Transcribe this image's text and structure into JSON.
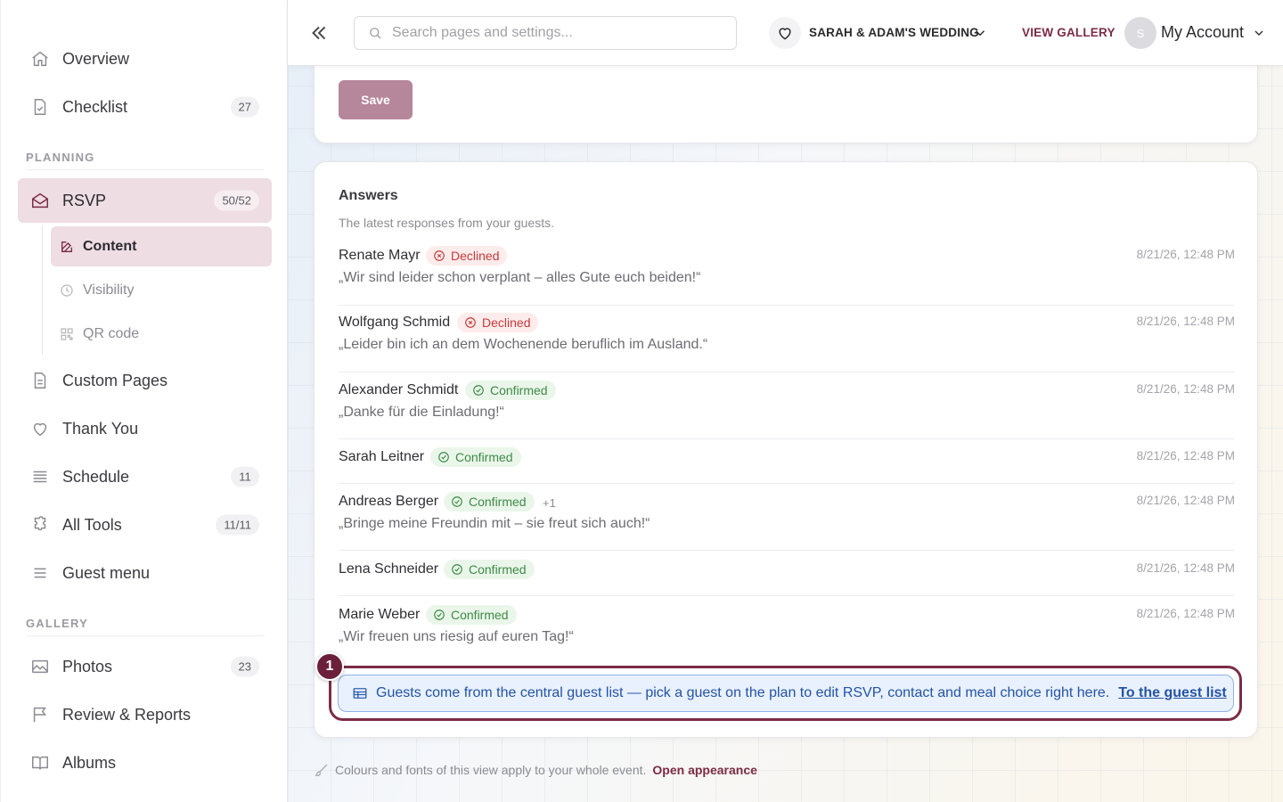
{
  "sidebar": {
    "items": [
      {
        "label": "Overview",
        "icon": "home-icon"
      },
      {
        "label": "Checklist",
        "icon": "checklist-icon",
        "count": "27"
      },
      {
        "label": "RSVP",
        "icon": "envelope-open-icon",
        "count": "50/52"
      },
      {
        "label": "Custom Pages",
        "icon": "page-icon"
      },
      {
        "label": "Thank You",
        "icon": "heart-icon"
      },
      {
        "label": "Schedule",
        "icon": "schedule-list-icon",
        "count": "11"
      },
      {
        "label": "All Tools",
        "icon": "puzzle-icon",
        "count": "11/11"
      },
      {
        "label": "Guest menu",
        "icon": "menu-lines-icon"
      },
      {
        "label": "Photos",
        "icon": "image-icon",
        "count": "23"
      },
      {
        "label": "Review & Reports",
        "icon": "flag-icon"
      },
      {
        "label": "Albums",
        "icon": "book-open-icon"
      }
    ],
    "sections": {
      "planning": "PLANNING",
      "gallery": "GALLERY"
    },
    "rsvp_sub": [
      {
        "label": "Content",
        "icon": "edit-icon"
      },
      {
        "label": "Visibility",
        "icon": "clock-icon"
      },
      {
        "label": "QR code",
        "icon": "qr-code-icon"
      }
    ]
  },
  "topbar": {
    "search_placeholder": "Search pages and settings...",
    "event_name": "SARAH & ADAM'S WEDDING",
    "view_gallery": "VIEW GALLERY",
    "avatar_initial": "S",
    "account_label": "My Account"
  },
  "form": {
    "save_label": "Save"
  },
  "answers": {
    "title": "Answers",
    "subtitle": "The latest responses from your guests.",
    "items": [
      {
        "name": "Renate Mayr",
        "status": "Declined",
        "quote": "„Wir sind leider schon verplant – alles Gute euch beiden!“",
        "time": "8/21/26, 12:48 PM"
      },
      {
        "name": "Wolfgang Schmid",
        "status": "Declined",
        "quote": "„Leider bin ich an dem Wochenende beruflich im Ausland.“",
        "time": "8/21/26, 12:48 PM"
      },
      {
        "name": "Alexander Schmidt",
        "status": "Confirmed",
        "quote": "„Danke für die Einladung!“",
        "time": "8/21/26, 12:48 PM"
      },
      {
        "name": "Sarah Leitner",
        "status": "Confirmed",
        "time": "8/21/26, 12:48 PM"
      },
      {
        "name": "Andreas Berger",
        "status": "Confirmed",
        "plus": "+1",
        "quote": "„Bringe meine Freundin mit – sie freut sich auch!“",
        "time": "8/21/26, 12:48 PM"
      },
      {
        "name": "Lena Schneider",
        "status": "Confirmed",
        "time": "8/21/26, 12:48 PM"
      },
      {
        "name": "Marie Weber",
        "status": "Confirmed",
        "quote": "„Wir freuen uns riesig auf euren Tag!“",
        "time": "8/21/26, 12:48 PM"
      }
    ]
  },
  "guide": {
    "step": "1",
    "text": "Guests come from the central guest list — pick a guest on the plan to edit RSVP, contact and meal choice right here.",
    "link": "To the guest list"
  },
  "footer": {
    "text": "Colours and fonts of this view apply to your whole event.",
    "link": "Open appearance"
  },
  "colors": {
    "accent": "#7b2c46",
    "active_bg": "#eedde2",
    "declined": "#c43a3a",
    "confirmed": "#3d8a46",
    "info": "#2453a6"
  }
}
